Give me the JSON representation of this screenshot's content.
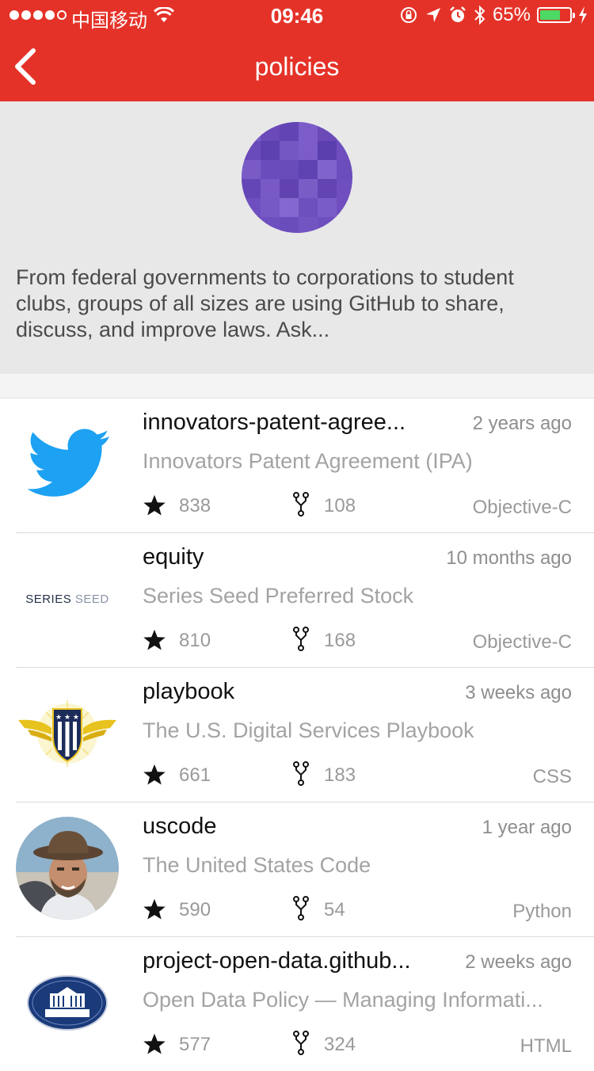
{
  "status_bar": {
    "carrier": "中国移动",
    "time": "09:46",
    "battery": "65%"
  },
  "nav": {
    "title": "policies"
  },
  "org": {
    "description": "From federal governments to corporations to student clubs, groups of all sizes are using GitHub to share, discuss, and improve laws.  Ask..."
  },
  "repos": [
    {
      "name": "innovators-patent-agree...",
      "description": "Innovators Patent Agreement (IPA)",
      "time": "2 years ago",
      "stars": "838",
      "forks": "108",
      "language": "Objective-C",
      "logo": "twitter-bird-icon"
    },
    {
      "name": "equity",
      "description": "Series Seed Preferred Stock",
      "time": "10 months ago",
      "stars": "810",
      "forks": "168",
      "language": "Objective-C",
      "logo": "series-seed-logo",
      "logo_text": "SERIES",
      "logo_text_light": "SEED"
    },
    {
      "name": "playbook",
      "description": "The U.S. Digital Services Playbook",
      "time": "3 weeks ago",
      "stars": "661",
      "forks": "183",
      "language": "CSS",
      "logo": "usds-shield-logo"
    },
    {
      "name": "uscode",
      "description": "The United States Code",
      "time": "1 year ago",
      "stars": "590",
      "forks": "54",
      "language": "Python",
      "logo": "user-avatar-photo"
    },
    {
      "name": "project-open-data.github...",
      "description": "Open Data Policy — Managing Informati...",
      "time": "2 weeks ago",
      "stars": "577",
      "forks": "324",
      "language": "HTML",
      "logo": "white-house-seal"
    }
  ],
  "colors": {
    "accent": "#e53228",
    "header_bg": "#e8e8e8",
    "avatar_purple": "#6f4fbf"
  }
}
